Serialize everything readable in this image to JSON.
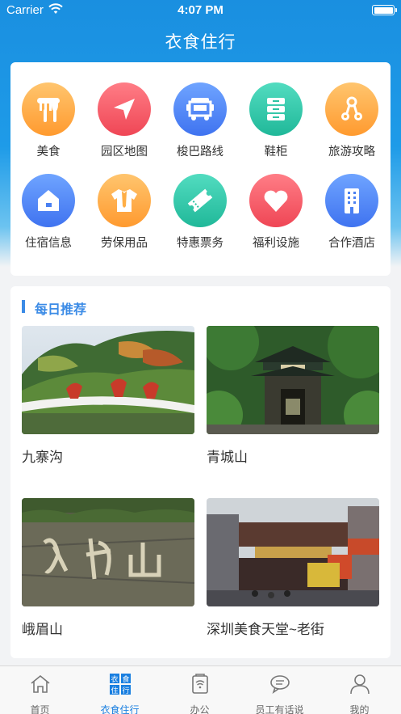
{
  "status_bar": {
    "carrier": "Carrier",
    "time": "4:07 PM"
  },
  "nav": {
    "title": "衣食住行"
  },
  "services": [
    {
      "label": "美食",
      "icon": "fork-knife-icon",
      "color": "orange"
    },
    {
      "label": "园区地图",
      "icon": "navigation-arrow-icon",
      "color": "red"
    },
    {
      "label": "梭巴路线",
      "icon": "bus-icon",
      "color": "blue"
    },
    {
      "label": "鞋柜",
      "icon": "cabinet-icon",
      "color": "teal"
    },
    {
      "label": "旅游攻略",
      "icon": "scooter-icon",
      "color": "orange"
    },
    {
      "label": "住宿信息",
      "icon": "house-icon",
      "color": "blue"
    },
    {
      "label": "劳保用品",
      "icon": "shirt-icon",
      "color": "orange"
    },
    {
      "label": "特惠票务",
      "icon": "ticket-icon",
      "color": "teal"
    },
    {
      "label": "福利设施",
      "icon": "heart-icon",
      "color": "red"
    },
    {
      "label": "合作酒店",
      "icon": "building-icon",
      "color": "blue"
    }
  ],
  "recommend": {
    "title": "每日推荐",
    "items": [
      {
        "name": "九寨沟"
      },
      {
        "name": "青城山"
      },
      {
        "name": "峨眉山"
      },
      {
        "name": "深圳美食天堂~老街"
      }
    ]
  },
  "tabs": [
    {
      "label": "首页",
      "icon": "home-icon"
    },
    {
      "label": "衣食住行",
      "icon": "grid-text-icon",
      "active": true
    },
    {
      "label": "办公",
      "icon": "briefcase-icon"
    },
    {
      "label": "员工有话说",
      "icon": "chat-bubble-icon"
    },
    {
      "label": "我的",
      "icon": "user-icon"
    }
  ],
  "tab_icon_text": [
    "衣",
    "食",
    "住",
    "行"
  ],
  "colors": {
    "primary": "#1a8fe0",
    "accent": "#3b8be6",
    "active_tab": "#1a7fe0"
  }
}
